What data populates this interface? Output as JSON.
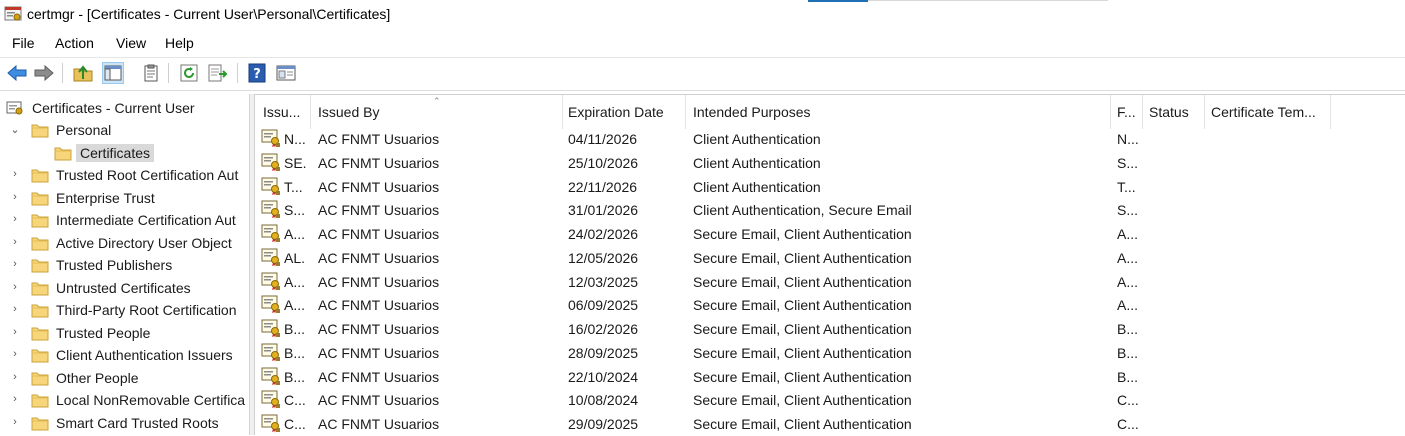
{
  "window": {
    "title": "certmgr - [Certificates - Current User\\Personal\\Certificates]",
    "accent_color": "#1f6fb5"
  },
  "menu": [
    "File",
    "Action",
    "View",
    "Help"
  ],
  "toolbar": {
    "icons": [
      "back-icon",
      "forward-icon",
      "up-folder-icon",
      "show-hide-tree-icon",
      "properties-icon",
      "refresh-icon",
      "export-list-icon",
      "help-icon",
      "mmc-view-icon"
    ]
  },
  "tree": {
    "root": "Certificates - Current User",
    "items": [
      {
        "label": "Personal",
        "expanded": true
      },
      {
        "label": "Certificates",
        "selected": true
      },
      {
        "label": "Trusted Root Certification Aut"
      },
      {
        "label": "Enterprise Trust"
      },
      {
        "label": "Intermediate Certification Aut"
      },
      {
        "label": "Active Directory User Object"
      },
      {
        "label": "Trusted Publishers"
      },
      {
        "label": "Untrusted Certificates"
      },
      {
        "label": "Third-Party Root Certification"
      },
      {
        "label": "Trusted People"
      },
      {
        "label": "Client Authentication Issuers"
      },
      {
        "label": "Other People"
      },
      {
        "label": "Local NonRemovable Certifica"
      },
      {
        "label": "Smart Card Trusted Roots"
      }
    ]
  },
  "list": {
    "columns": [
      "Issu...",
      "Issued By",
      "Expiration Date",
      "Intended Purposes",
      "F...",
      "Status",
      "Certificate Tem..."
    ],
    "rows": [
      {
        "issued_to": "N...",
        "issued_by": "AC FNMT Usuarios",
        "expiration": "04/11/2026",
        "purposes": "Client Authentication",
        "friendly": "N..."
      },
      {
        "issued_to": "SE...",
        "issued_by": "AC FNMT Usuarios",
        "expiration": "25/10/2026",
        "purposes": "Client Authentication",
        "friendly": "S..."
      },
      {
        "issued_to": "T...",
        "issued_by": "AC FNMT Usuarios",
        "expiration": "22/11/2026",
        "purposes": "Client Authentication",
        "friendly": "T..."
      },
      {
        "issued_to": "S...",
        "issued_by": "AC FNMT Usuarios",
        "expiration": "31/01/2026",
        "purposes": "Client Authentication, Secure Email",
        "friendly": "S..."
      },
      {
        "issued_to": "A...",
        "issued_by": "AC FNMT Usuarios",
        "expiration": "24/02/2026",
        "purposes": "Secure Email, Client Authentication",
        "friendly": "A..."
      },
      {
        "issued_to": "AL...",
        "issued_by": "AC FNMT Usuarios",
        "expiration": "12/05/2026",
        "purposes": "Secure Email, Client Authentication",
        "friendly": "A..."
      },
      {
        "issued_to": "A...",
        "issued_by": "AC FNMT Usuarios",
        "expiration": "12/03/2025",
        "purposes": "Secure Email, Client Authentication",
        "friendly": "A..."
      },
      {
        "issued_to": "A...",
        "issued_by": "AC FNMT Usuarios",
        "expiration": "06/09/2025",
        "purposes": "Secure Email, Client Authentication",
        "friendly": "A..."
      },
      {
        "issued_to": "B...",
        "issued_by": "AC FNMT Usuarios",
        "expiration": "16/02/2026",
        "purposes": "Secure Email, Client Authentication",
        "friendly": "B..."
      },
      {
        "issued_to": "B...",
        "issued_by": "AC FNMT Usuarios",
        "expiration": "28/09/2025",
        "purposes": "Secure Email, Client Authentication",
        "friendly": "B..."
      },
      {
        "issued_to": "B...",
        "issued_by": "AC FNMT Usuarios",
        "expiration": "22/10/2024",
        "purposes": "Secure Email, Client Authentication",
        "friendly": "B..."
      },
      {
        "issued_to": "C...",
        "issued_by": "AC FNMT Usuarios",
        "expiration": "10/08/2024",
        "purposes": "Secure Email, Client Authentication",
        "friendly": "C..."
      },
      {
        "issued_to": "C...",
        "issued_by": "AC FNMT Usuarios",
        "expiration": "29/09/2025",
        "purposes": "Secure Email, Client Authentication",
        "friendly": "C..."
      }
    ]
  }
}
